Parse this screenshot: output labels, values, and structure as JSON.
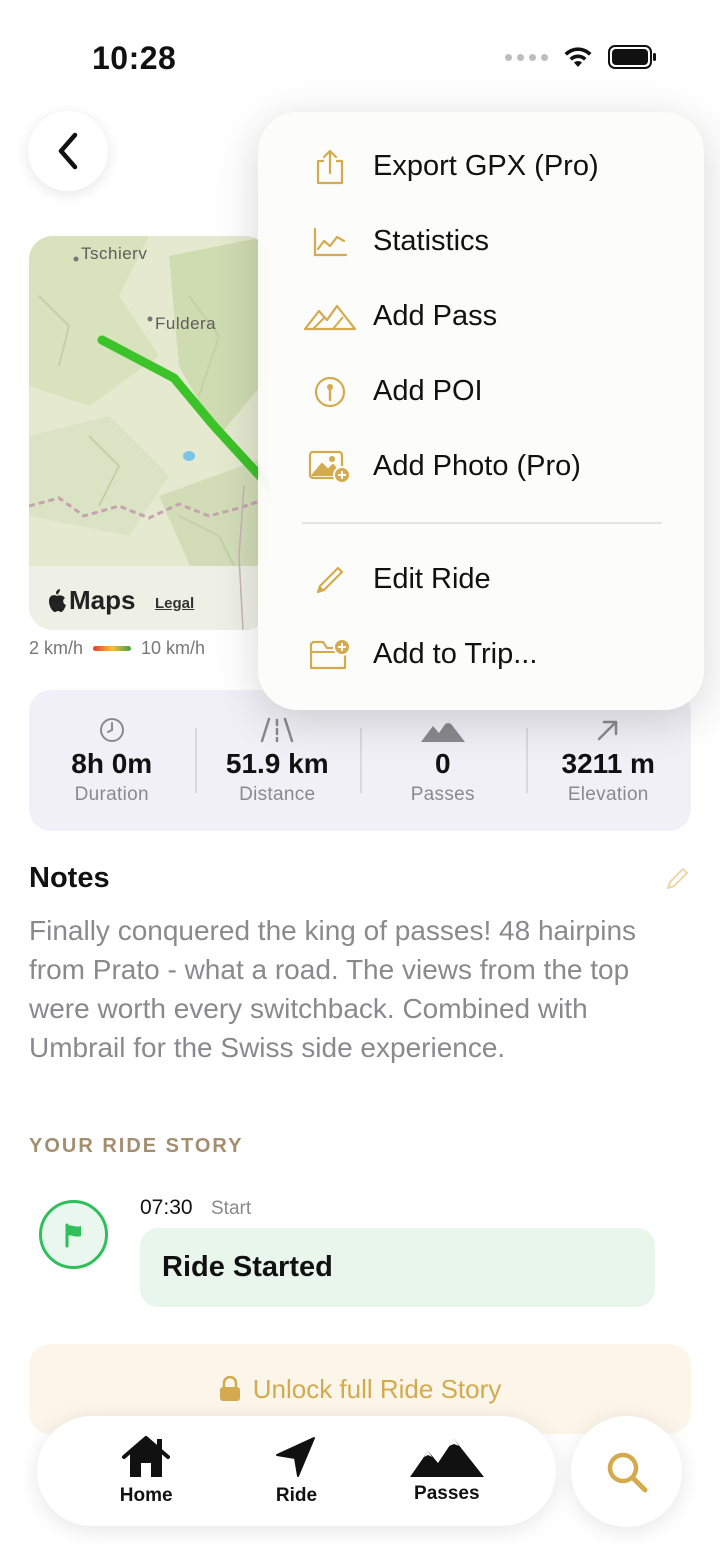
{
  "status": {
    "time": "10:28"
  },
  "map": {
    "places": [
      "Tschierv",
      "Fuldera"
    ],
    "logo": "Maps",
    "legal": "Legal",
    "speed_min": "2 km/h",
    "speed_max": "10 km/h"
  },
  "stats": [
    {
      "icon": "clock-icon",
      "value": "8h 0m",
      "label": "Duration"
    },
    {
      "icon": "road-icon",
      "value": "51.9 km",
      "label": "Distance"
    },
    {
      "icon": "mountains-icon",
      "value": "0",
      "label": "Passes"
    },
    {
      "icon": "arrow-up-right-icon",
      "value": "3211 m",
      "label": "Elevation"
    }
  ],
  "notes": {
    "title": "Notes",
    "body": "Finally conquered the king of passes! 48 hairpins from Prato - what a road. The views from the top were worth every switchback. Combined with Umbrail for the Swiss side experience."
  },
  "story": {
    "title": "YOUR RIDE STORY",
    "events": [
      {
        "time": "07:30",
        "kind": "Start",
        "title": "Ride Started"
      }
    ],
    "unlock_label": "Unlock full Ride Story"
  },
  "tabs": [
    {
      "label": "Home",
      "icon": "house-icon"
    },
    {
      "label": "Ride",
      "icon": "navigation-arrow-icon"
    },
    {
      "label": "Passes",
      "icon": "mountains-icon"
    }
  ],
  "menu": {
    "items": [
      {
        "label": "Export GPX (Pro)",
        "icon": "share-icon"
      },
      {
        "label": "Statistics",
        "icon": "chart-icon"
      },
      {
        "label": "Add Pass",
        "icon": "mountains-icon"
      },
      {
        "label": "Add POI",
        "icon": "pin-icon"
      },
      {
        "label": "Add Photo (Pro)",
        "icon": "photo-add-icon"
      },
      {
        "label": "Edit Ride",
        "icon": "pencil-icon"
      },
      {
        "label": "Add to Trip...",
        "icon": "folder-add-icon"
      }
    ]
  },
  "colors": {
    "accent": "#d4aa4e",
    "route": "#3cc32a",
    "stats_bg": "#f0f0f6",
    "story_green": "#2fbf5b"
  }
}
